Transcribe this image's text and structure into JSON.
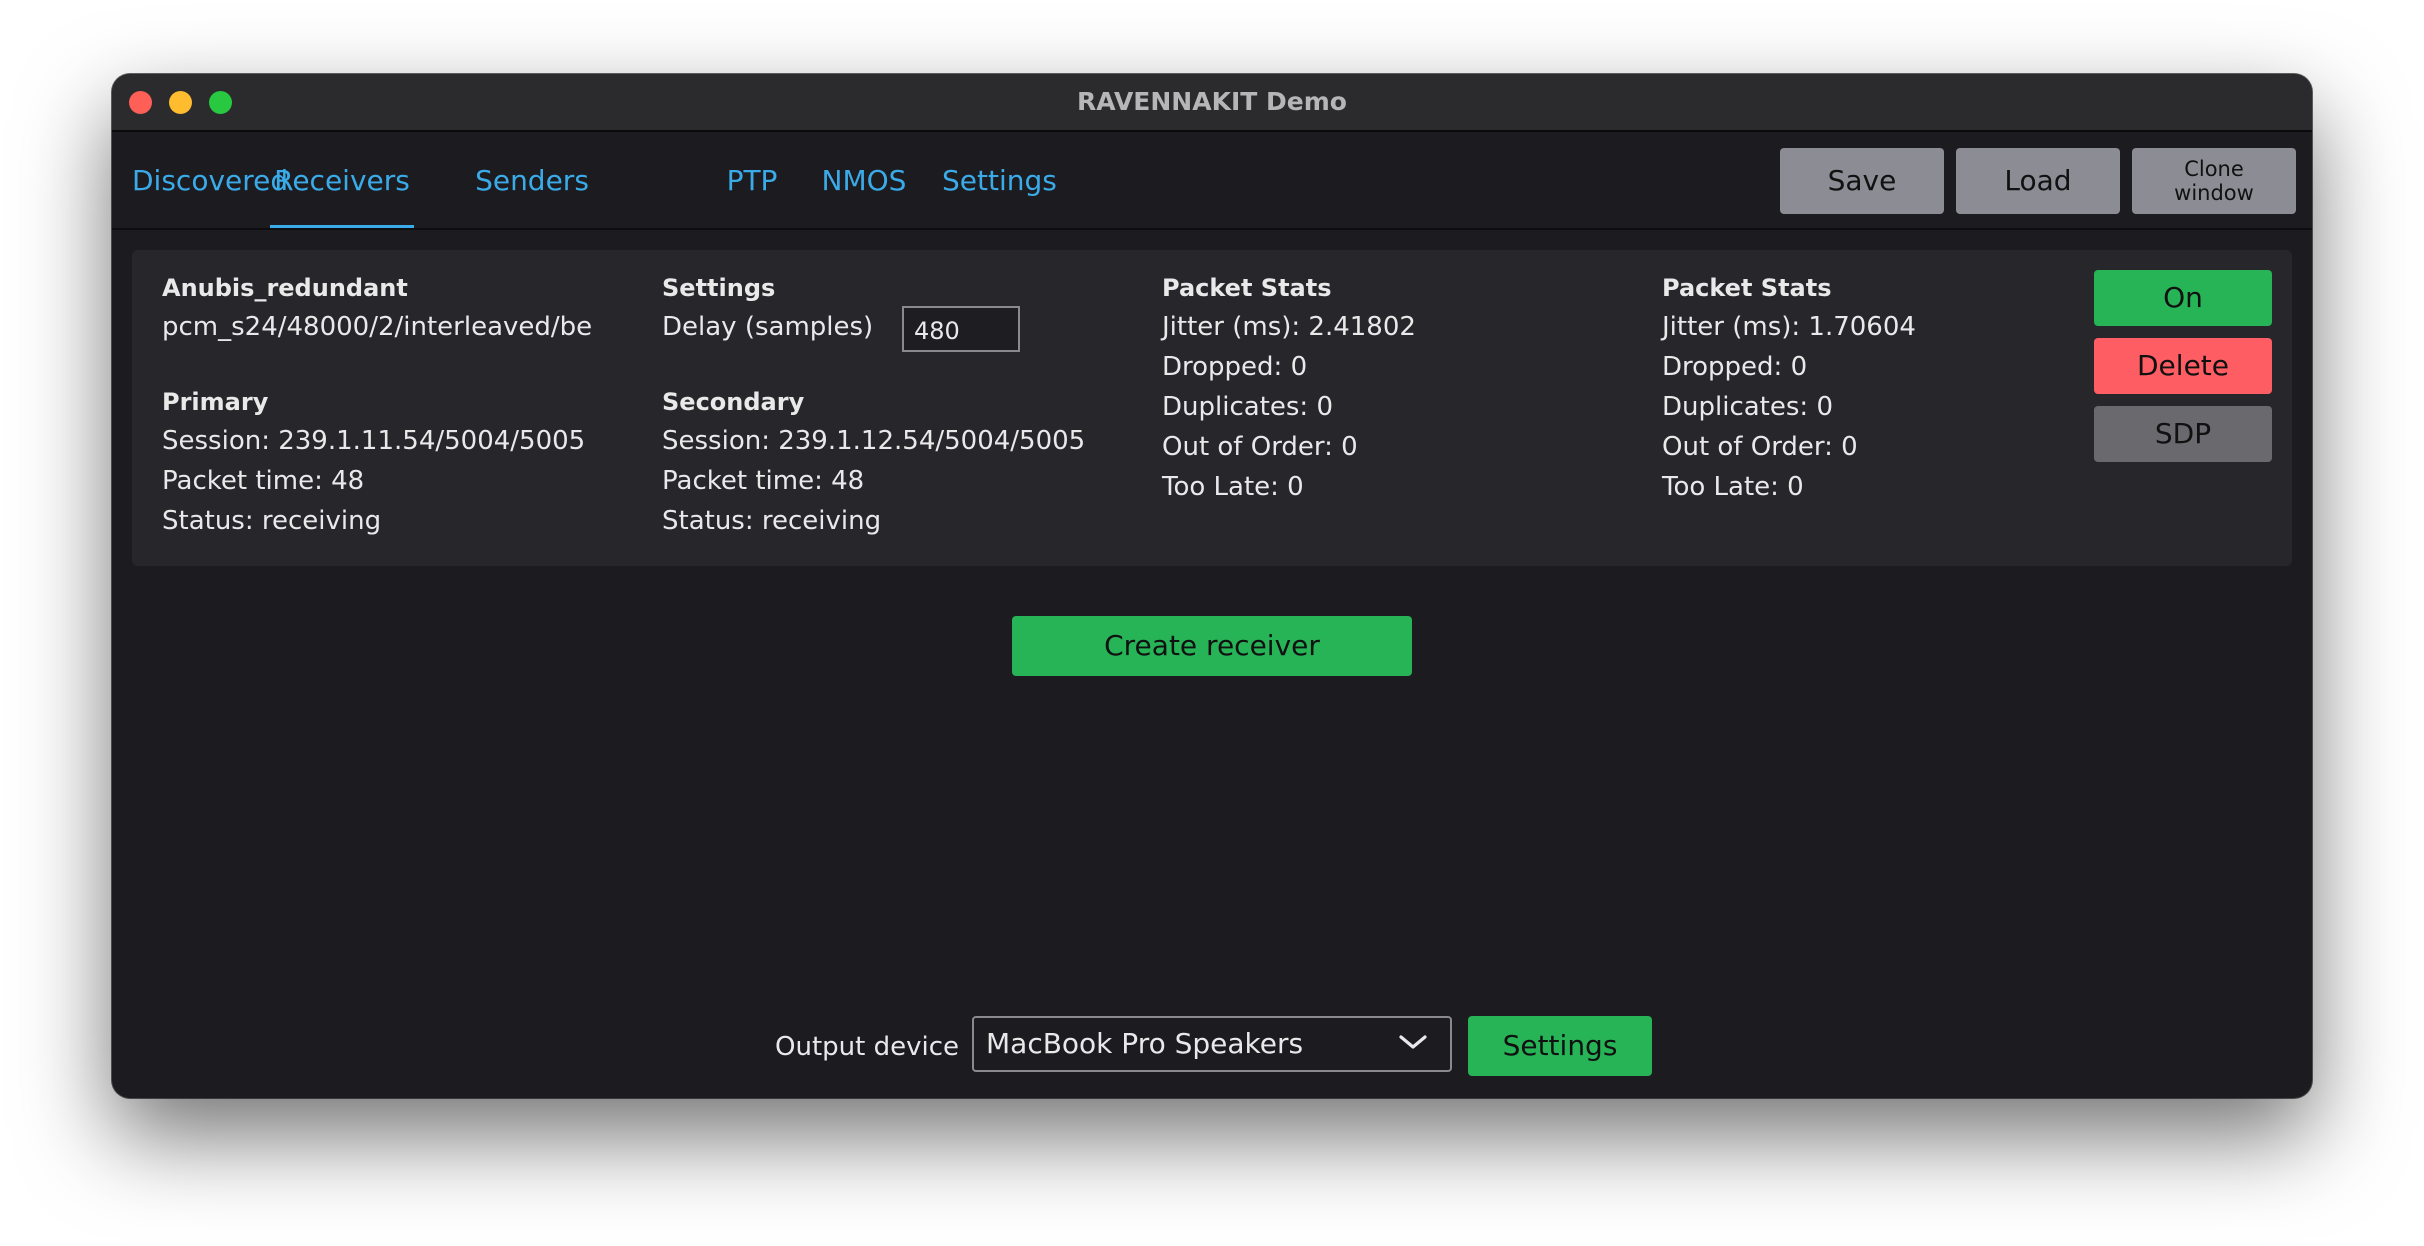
{
  "window": {
    "title": "RAVENNAKIT Demo"
  },
  "tabs": [
    {
      "label": "Discovered",
      "active": false
    },
    {
      "label": "Receivers",
      "active": true
    },
    {
      "label": "Senders",
      "active": false
    },
    {
      "label": "PTP",
      "active": false
    },
    {
      "label": "NMOS",
      "active": false
    },
    {
      "label": "Settings",
      "active": false
    }
  ],
  "toolbar": {
    "save_label": "Save",
    "load_label": "Load",
    "clone_label_line1": "Clone",
    "clone_label_line2": "window"
  },
  "receiver": {
    "name": "Anubis_redundant",
    "format": "pcm_s24/48000/2/interleaved/be",
    "settings_heading": "Settings",
    "delay_label": "Delay (samples)",
    "delay_value": "480",
    "primary": {
      "heading": "Primary",
      "session": "Session: 239.1.11.54/5004/5005",
      "packet_time": "Packet time: 48",
      "status": "Status: receiving"
    },
    "secondary": {
      "heading": "Secondary",
      "session": "Session: 239.1.12.54/5004/5005",
      "packet_time": "Packet time: 48",
      "status": "Status: receiving"
    },
    "stats_primary": {
      "heading": "Packet Stats",
      "jitter": "Jitter (ms): 2.41802",
      "dropped": "Dropped: 0",
      "duplicates": "Duplicates: 0",
      "out_of_order": "Out of Order: 0",
      "too_late": "Too Late: 0"
    },
    "stats_secondary": {
      "heading": "Packet Stats",
      "jitter": "Jitter (ms): 1.70604",
      "dropped": "Dropped: 0",
      "duplicates": "Duplicates: 0",
      "out_of_order": "Out of Order: 0",
      "too_late": "Too Late: 0"
    },
    "buttons": {
      "on_label": "On",
      "delete_label": "Delete",
      "sdp_label": "SDP"
    }
  },
  "create_receiver_label": "Create receiver",
  "output": {
    "label": "Output device",
    "selected": "MacBook Pro Speakers",
    "settings_label": "Settings"
  },
  "colors": {
    "accent_blue": "#3aabe8",
    "green": "#27b457",
    "red": "#fd5d63",
    "gray_button": "#8c8c94",
    "sdp_gray": "#6a6a6e",
    "background": "#1c1c20",
    "panel": "#27272b"
  },
  "icons": {
    "dropdown": "chevron-down-icon"
  }
}
